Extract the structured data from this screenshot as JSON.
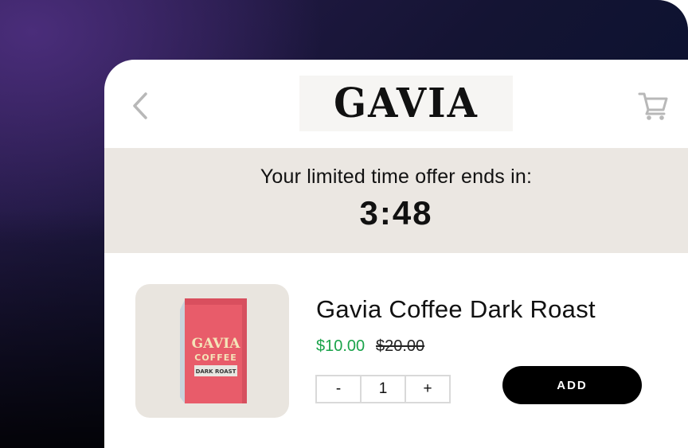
{
  "header": {
    "logo_text": "GAVIA",
    "back_icon": "chevron-left-icon",
    "cart_icon": "shopping-cart-icon"
  },
  "offer": {
    "message": "Your limited time offer ends in:",
    "countdown": "3:48",
    "background_color": "#ebe7e2"
  },
  "product": {
    "name": "Gavia Coffee Dark Roast",
    "sale_price": "$10.00",
    "original_price": "$20.00",
    "sale_price_color": "#1aa34a",
    "image": {
      "brand_line1": "GAVIA",
      "brand_line2": "COFFEE",
      "roast_label": "DARK ROAST",
      "bag_color": "#e85c6a"
    }
  },
  "quantity": {
    "decrement_label": "-",
    "value": "1",
    "increment_label": "+"
  },
  "add_button": {
    "label": "ADD"
  }
}
